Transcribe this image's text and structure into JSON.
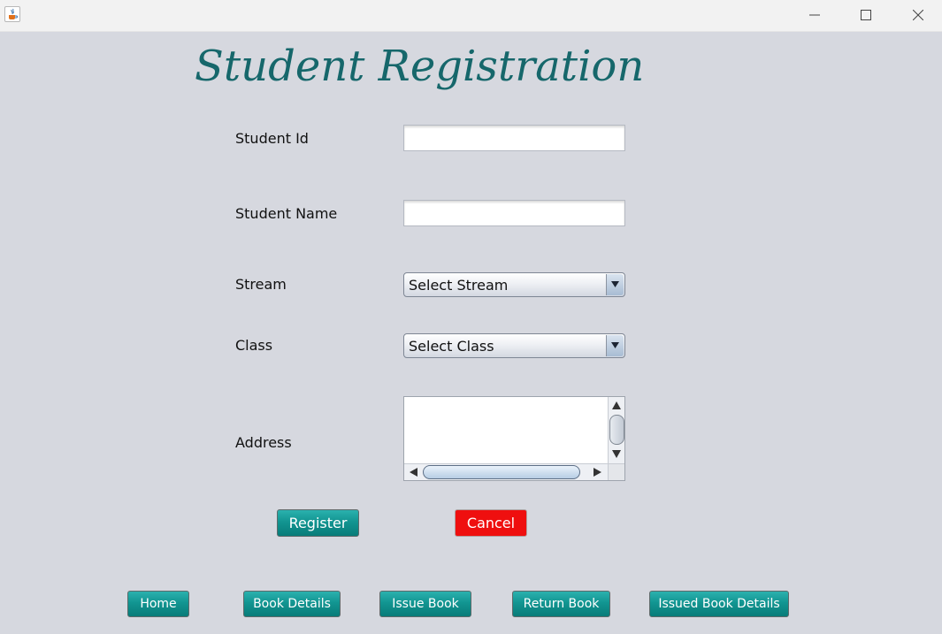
{
  "page_title": "Student Registration",
  "form": {
    "student_id_label": "Student Id",
    "student_id_value": "",
    "student_name_label": "Student Name",
    "student_name_value": "",
    "stream_label": "Stream",
    "stream_selected": "Select Stream",
    "class_label": "Class",
    "class_selected": "Select Class",
    "address_label": "Address",
    "address_value": ""
  },
  "actions": {
    "register_label": "Register",
    "cancel_label": "Cancel"
  },
  "nav": {
    "home_label": "Home",
    "book_details_label": "Book Details",
    "issue_book_label": "Issue Book",
    "return_book_label": "Return Book",
    "issued_book_details_label": "Issued Book Details"
  },
  "colors": {
    "background": "#d6d8df",
    "title": "#16676b",
    "teal_button": "#129591",
    "cancel_button": "#ef0f0f"
  },
  "icons": {
    "app": "java-app-icon",
    "minimize": "minimize-icon",
    "maximize": "maximize-icon",
    "close": "close-icon"
  }
}
